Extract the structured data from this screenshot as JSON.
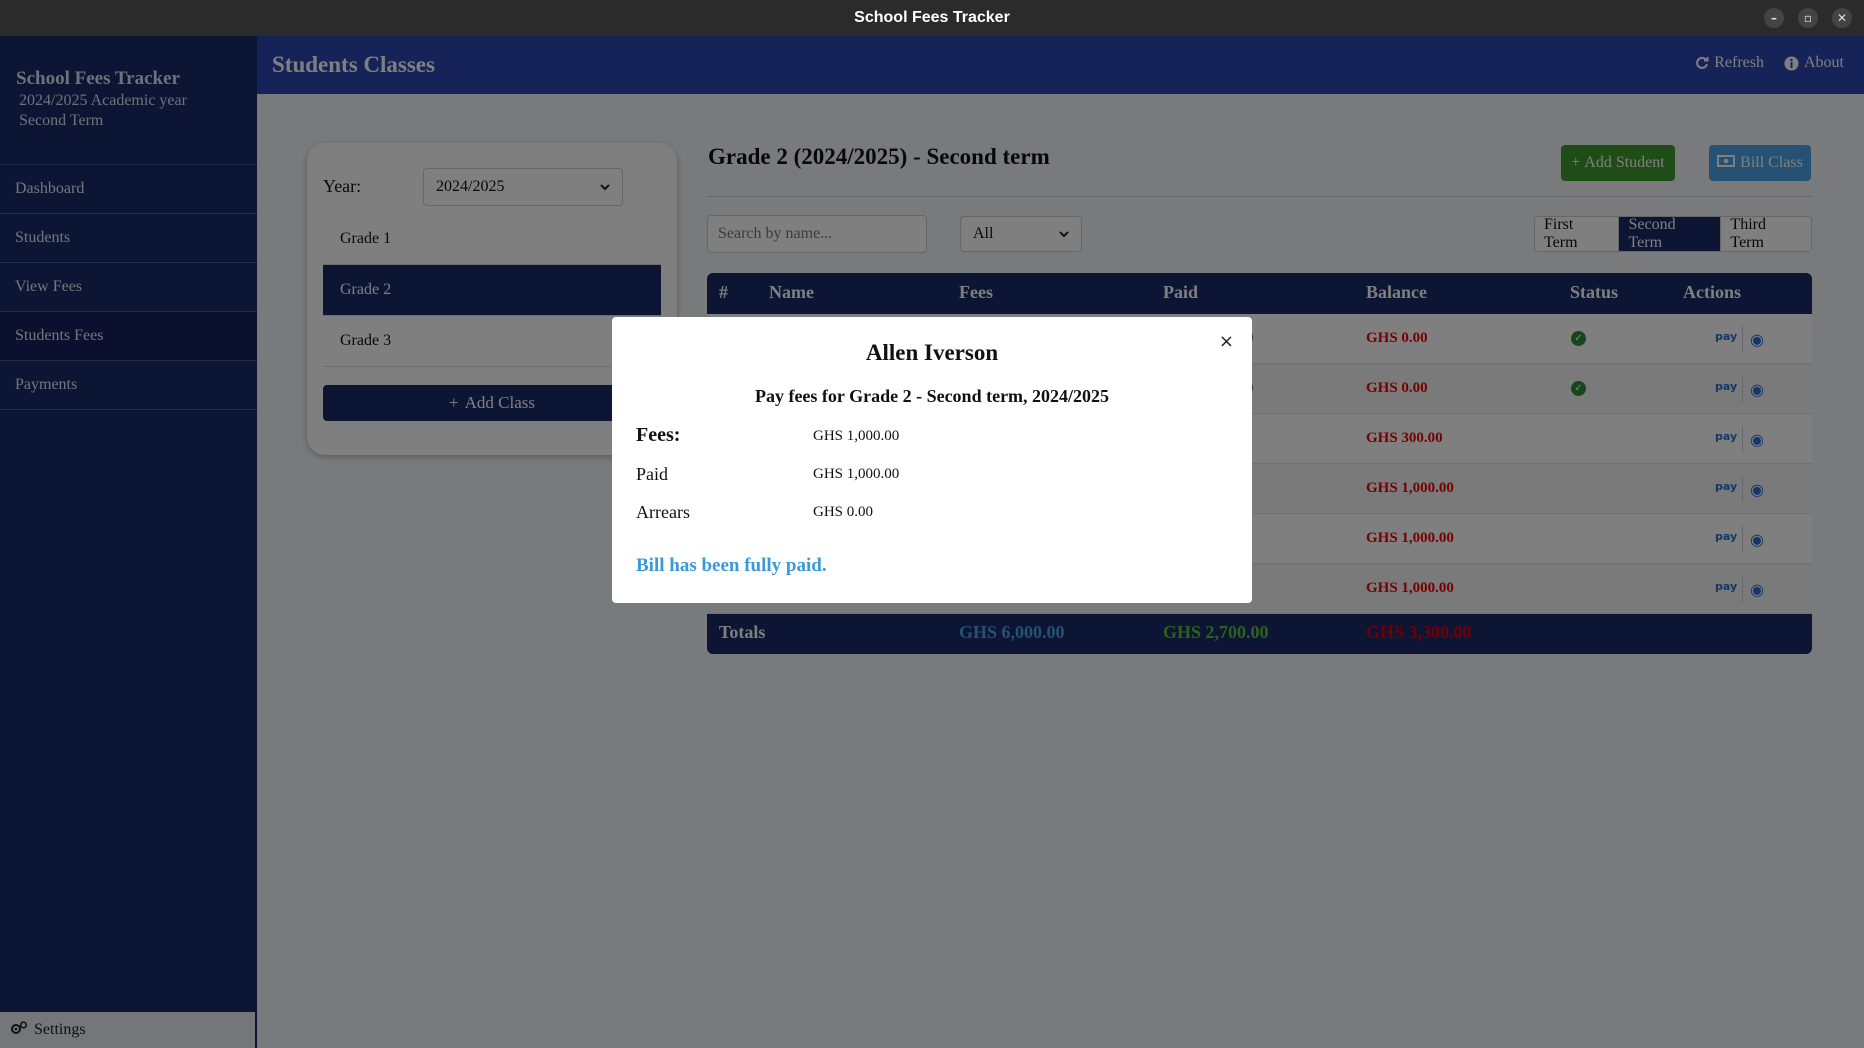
{
  "window": {
    "title": "School Fees Tracker",
    "controls": [
      "–",
      "▫",
      "✕"
    ]
  },
  "sidebar": {
    "app_name": "School Fees Tracker",
    "academic_year": "2024/2025 Academic year",
    "term": "Second Term",
    "items": [
      {
        "label": "Dashboard"
      },
      {
        "label": "Students"
      },
      {
        "label": "View Fees"
      },
      {
        "label": "Students Fees"
      },
      {
        "label": "Payments"
      }
    ],
    "settings_label": "Settings"
  },
  "header": {
    "title": "Students Classes",
    "refresh": "Refresh",
    "about": "About"
  },
  "class_panel": {
    "year_label": "Year:",
    "year_value": "2024/2025",
    "classes": [
      "Grade 1",
      "Grade 2",
      "Grade 3"
    ],
    "add_class": "Add Class"
  },
  "main": {
    "title": "Grade 2 (2024/2025) - Second term",
    "add_student": "Add Student",
    "bill_class": "Bill Class",
    "search_placeholder": "Search by name...",
    "filter_value": "All",
    "terms": [
      "First Term",
      "Second Term",
      "Third Term"
    ]
  },
  "table": {
    "headers": [
      "#",
      "Name",
      "Fees",
      "Paid",
      "Balance",
      "Status",
      "Actions"
    ],
    "rows": [
      {
        "paid_fragment": "0",
        "balance": "GHS 0.00",
        "paid_status": true
      },
      {
        "paid_fragment": "0",
        "balance": "GHS 0.00",
        "paid_status": true
      },
      {
        "paid_fragment": "",
        "balance": "GHS 300.00",
        "paid_status": false
      },
      {
        "paid_fragment": "",
        "balance": "GHS 1,000.00",
        "paid_status": false
      },
      {
        "paid_fragment": "",
        "balance": "GHS 1,000.00",
        "paid_status": false
      },
      {
        "paid_fragment": "",
        "balance": "GHS 1,000.00",
        "paid_status": false
      }
    ],
    "totals": {
      "label": "Totals",
      "fees": "GHS 6,000.00",
      "paid": "GHS 2,700.00",
      "balance": "GHS 3,300.00"
    },
    "action_pay_text": "pay",
    "colors": {
      "fees_total": "#4aa3e8",
      "paid_total": "#5cc23a",
      "balance_total": "#e00000"
    }
  },
  "modal": {
    "student_name": "Allen Iverson",
    "subtitle": "Pay fees for Grade 2 - Second term, 2024/2025",
    "fees_label": "Fees:",
    "fees_value": "GHS 1,000.00",
    "paid_label": "Paid",
    "paid_value": "GHS 1,000.00",
    "arrears_label": "Arrears",
    "arrears_value": "GHS 0.00",
    "message": "Bill has been fully paid.",
    "close": "×"
  }
}
